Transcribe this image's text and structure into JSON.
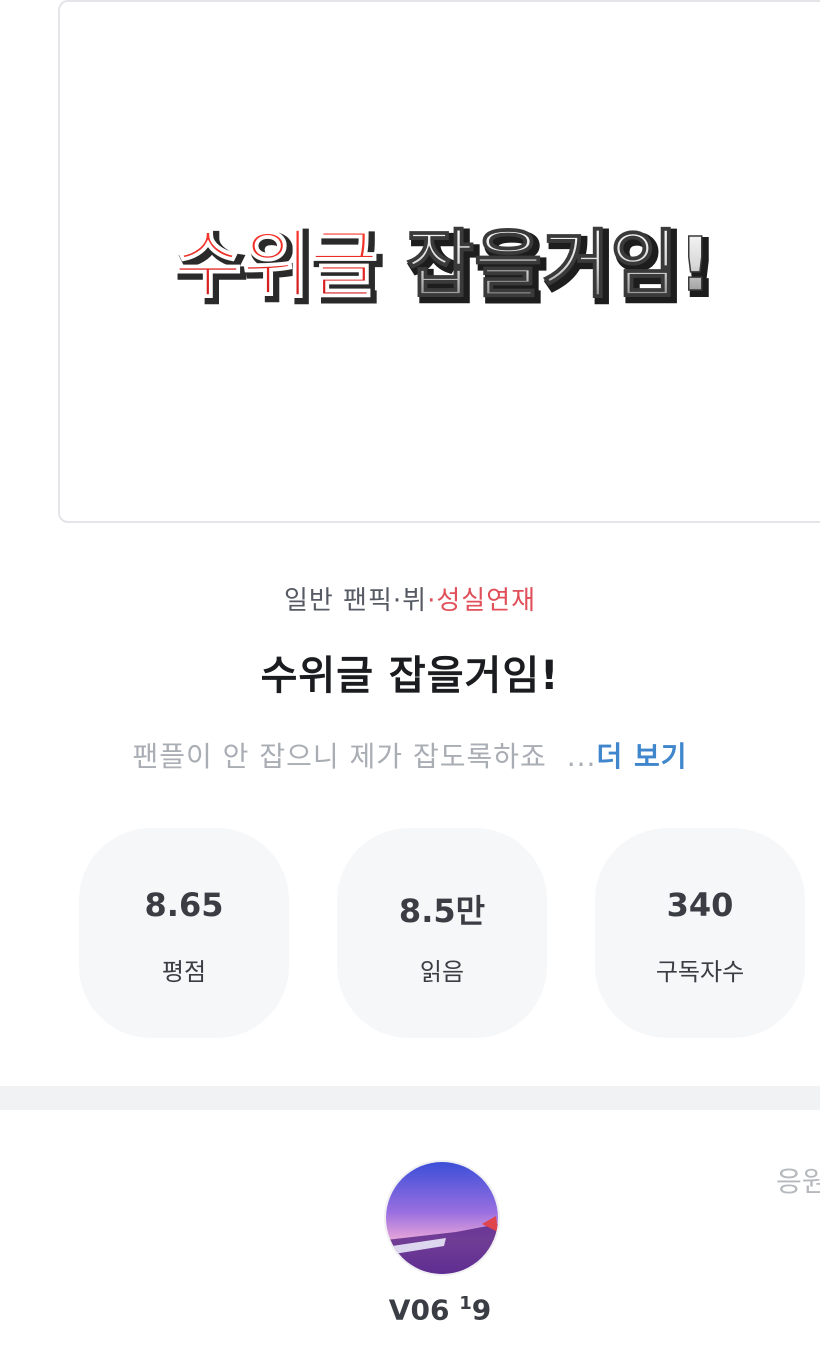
{
  "cover": {
    "title_part1": "수위글",
    "title_part2": "잡을거임!"
  },
  "meta": {
    "genre": "일반 팬픽·뷔",
    "separator": "·",
    "badge": "성실연재"
  },
  "title": "수위글 잡을거임!",
  "description": {
    "text": "팬플이 안 잡으니 제가 잡도록하죠",
    "ellipsis": "...",
    "more_label": "더 보기"
  },
  "stats": [
    {
      "value": "8.65",
      "label": "평점"
    },
    {
      "value": "8.5만",
      "label": "읽음"
    },
    {
      "value": "340",
      "label": "구독자수"
    }
  ],
  "author": {
    "name": "V06",
    "superscript": "1",
    "suffix": "9"
  },
  "cheer_label": "응원"
}
